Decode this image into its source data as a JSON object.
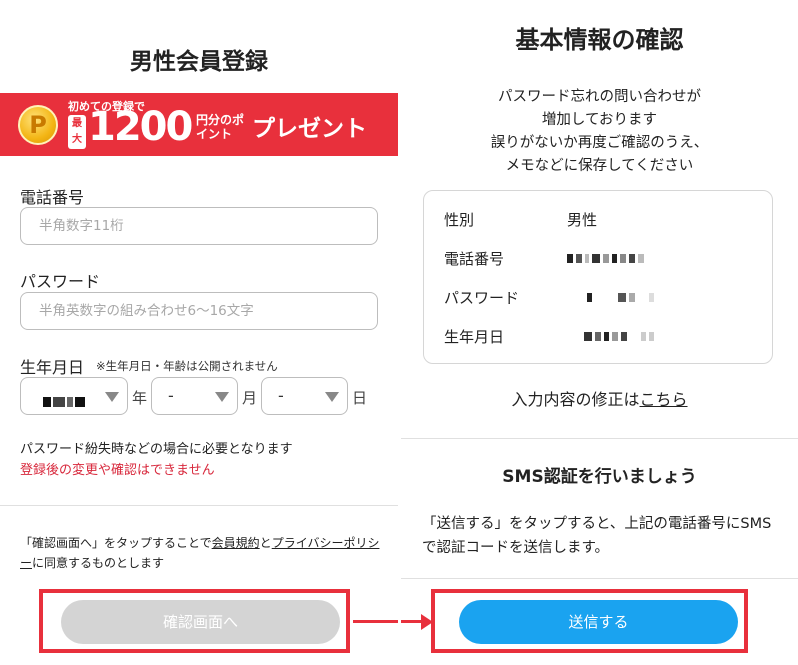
{
  "left": {
    "title": "男性会員登録",
    "banner": {
      "coin": "P",
      "small": "初めての登録で",
      "badge": "最大",
      "amount": "1200",
      "unit": "円分のポイント",
      "present": "プレゼント"
    },
    "phone_label": "電話番号",
    "phone_placeholder": "半角数字11桁",
    "password_label": "パスワード",
    "password_placeholder": "半角英数字の組み合わせ6〜16文字",
    "birth_label": "生年月日",
    "birth_note": "※生年月日・年齢は公開されません",
    "month_value": "-",
    "day_value": "-",
    "unit_year": "年",
    "unit_month": "月",
    "unit_day": "日",
    "note": "パスワード紛失時などの場合に必要となります",
    "warning": "登録後の変更や確認はできません",
    "terms_1": "「確認画面へ」をタップすることで",
    "terms_link1": "会員規約",
    "terms_2": "と",
    "terms_link2": "プライバシーポリシー",
    "terms_3": "に同意するものとします",
    "confirm_button": "確認画面へ"
  },
  "right": {
    "title": "基本情報の確認",
    "desc_lines": [
      "パスワード忘れの問い合わせが",
      "増加しております",
      "誤りがないか再度ご確認のうえ、",
      "メモなどに保存してください"
    ],
    "rows": [
      {
        "label": "性別",
        "value": "男性"
      },
      {
        "label": "電話番号",
        "value": ""
      },
      {
        "label": "パスワード",
        "value": ""
      },
      {
        "label": "生年月日",
        "value": ""
      }
    ],
    "edit_text": "入力内容の修正は",
    "edit_link": "こちら",
    "sms_title": "SMS認証を行いましょう",
    "sms_desc": "「送信する」をタップすると、上記の電話番号にSMSで認証コードを送信します。",
    "send_button": "送信する"
  },
  "colors": {
    "accent_red": "#e8303c",
    "button_blue": "#1aa3f0",
    "button_disabled": "#d4d4d4"
  }
}
